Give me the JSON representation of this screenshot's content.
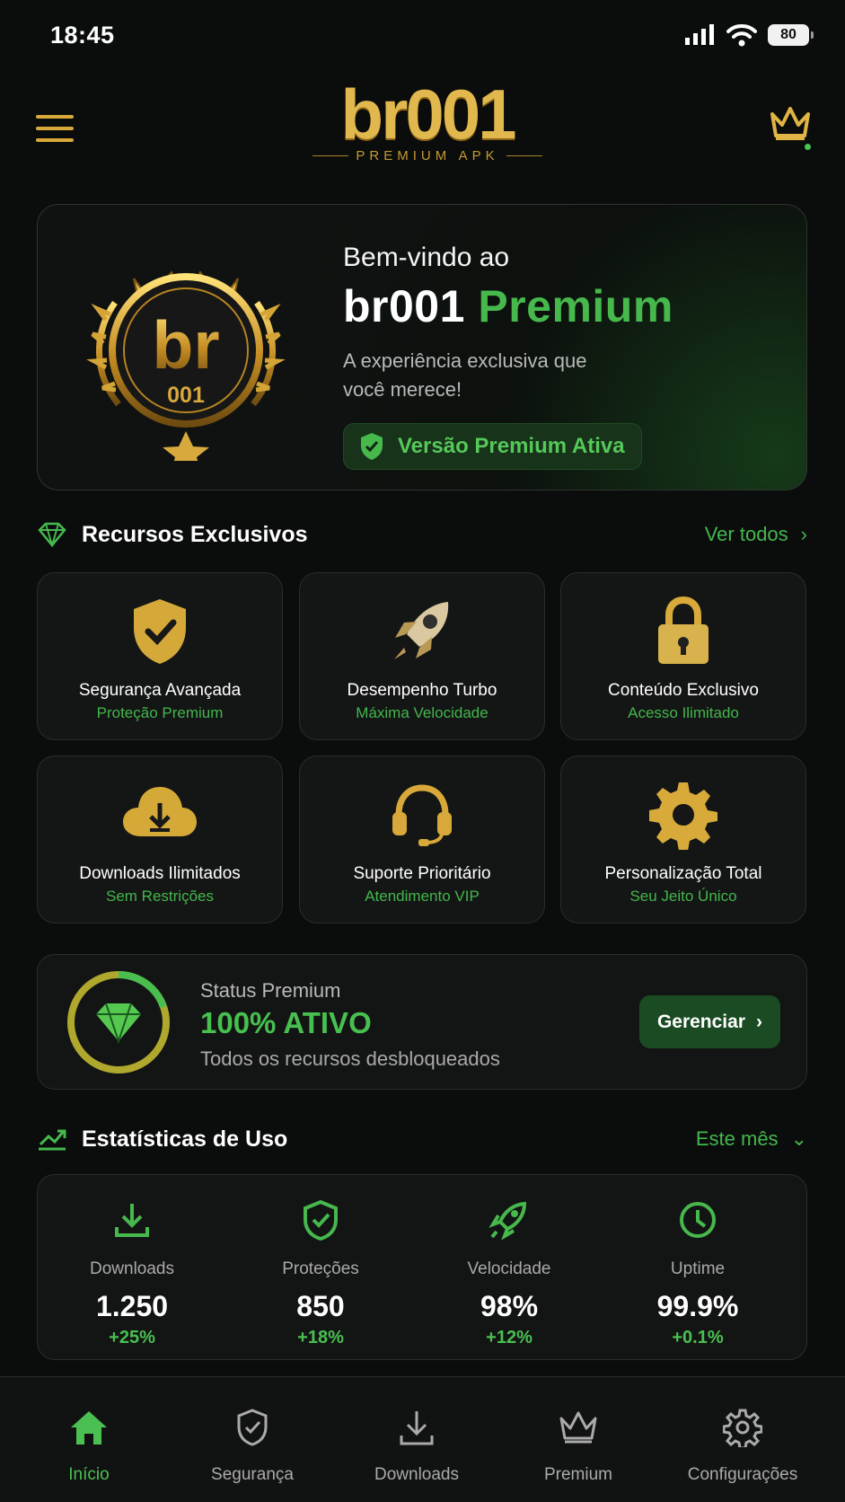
{
  "status_bar": {
    "time": "18:45",
    "battery": "80"
  },
  "app": {
    "logo": "br001",
    "logo_subtitle": "PREMIUM APK"
  },
  "hero": {
    "badge_main": "br",
    "badge_number": "001",
    "welcome": "Bem-vindo ao",
    "title_name": "br001",
    "title_accent": "Premium",
    "description": "A experiência exclusiva que você merece!",
    "status": "Versão Premium Ativa"
  },
  "features_section": {
    "title": "Recursos Exclusivos",
    "link": "Ver todos",
    "items": [
      {
        "title": "Segurança Avançada",
        "subtitle": "Proteção Premium",
        "icon": "shield-check-icon"
      },
      {
        "title": "Desempenho Turbo",
        "subtitle": "Máxima Velocidade",
        "icon": "rocket-icon"
      },
      {
        "title": "Conteúdo Exclusivo",
        "subtitle": "Acesso Ilimitado",
        "icon": "lock-icon"
      },
      {
        "title": "Downloads Ilimitados",
        "subtitle": "Sem Restrições",
        "icon": "cloud-download-icon"
      },
      {
        "title": "Suporte Prioritário",
        "subtitle": "Atendimento VIP",
        "icon": "headset-icon"
      },
      {
        "title": "Personalização Total",
        "subtitle": "Seu Jeito Único",
        "icon": "gear-icon"
      }
    ]
  },
  "premium_status": {
    "label": "Status Premium",
    "value": "100% ATIVO",
    "description": "Todos os recursos desbloqueados",
    "button": "Gerenciar",
    "progress": 1
  },
  "stats_section": {
    "title": "Estatísticas de Uso",
    "period": "Este mês",
    "items": [
      {
        "label": "Downloads",
        "value": "1.250",
        "delta": "+25%",
        "icon": "download-icon"
      },
      {
        "label": "Proteções",
        "value": "850",
        "delta": "+18%",
        "icon": "shield-check-icon"
      },
      {
        "label": "Velocidade",
        "value": "98%",
        "delta": "+12%",
        "icon": "rocket-icon"
      },
      {
        "label": "Uptime",
        "value": "99.9%",
        "delta": "+0.1%",
        "icon": "clock-icon"
      }
    ]
  },
  "bottom_nav": [
    {
      "label": "Início",
      "icon": "home-icon",
      "active": true
    },
    {
      "label": "Segurança",
      "icon": "shield-check-icon",
      "active": false
    },
    {
      "label": "Downloads",
      "icon": "download-icon",
      "active": false
    },
    {
      "label": "Premium",
      "icon": "crown-icon",
      "active": false
    },
    {
      "label": "Configurações",
      "icon": "gear-icon",
      "active": false
    }
  ],
  "colors": {
    "accent": "#46b84c",
    "gold": "#e2b73d",
    "background": "#0b0c0c"
  }
}
